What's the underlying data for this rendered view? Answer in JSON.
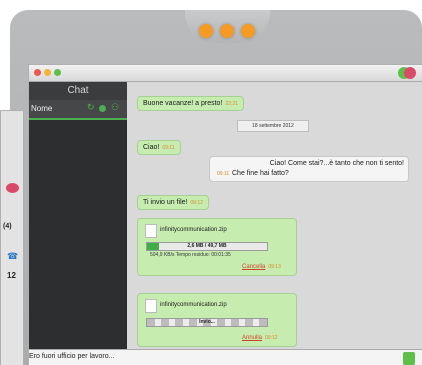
{
  "window": {
    "title": "Chat"
  },
  "sidebar": {
    "header": "Chat",
    "column_label": "Nome"
  },
  "messages": [
    {
      "text": "Buone vacanze! a presto!",
      "time": "22:21"
    },
    {
      "date": "18 settembre 2012"
    },
    {
      "text": "Ciao!",
      "time": "09:11"
    },
    {
      "text": "Ciao! Come stai?...è tanto che non ti sento!",
      "text2": "Che fine hai fatto?",
      "time": "09:11"
    },
    {
      "text": "Ti invio un file!",
      "time": "09:12"
    }
  ],
  "file1": {
    "name": "infinitycommunication.zip",
    "progress_text": "2,6 MB / 49,7 MB",
    "progress_fraction": 0.1,
    "speed_text": "504,9 KB/s Tempo residuo: 00:01:35",
    "cancel_label": "Cancella",
    "time": "09:13"
  },
  "file2": {
    "name": "infinitycommunication.zip",
    "status": "Invio...",
    "cancel_label": "Annulla",
    "time": "09:12"
  },
  "input": {
    "value": "Ero fuori ufficio per lavoro..."
  },
  "left_window": {
    "count": "(4)",
    "value": "12"
  }
}
